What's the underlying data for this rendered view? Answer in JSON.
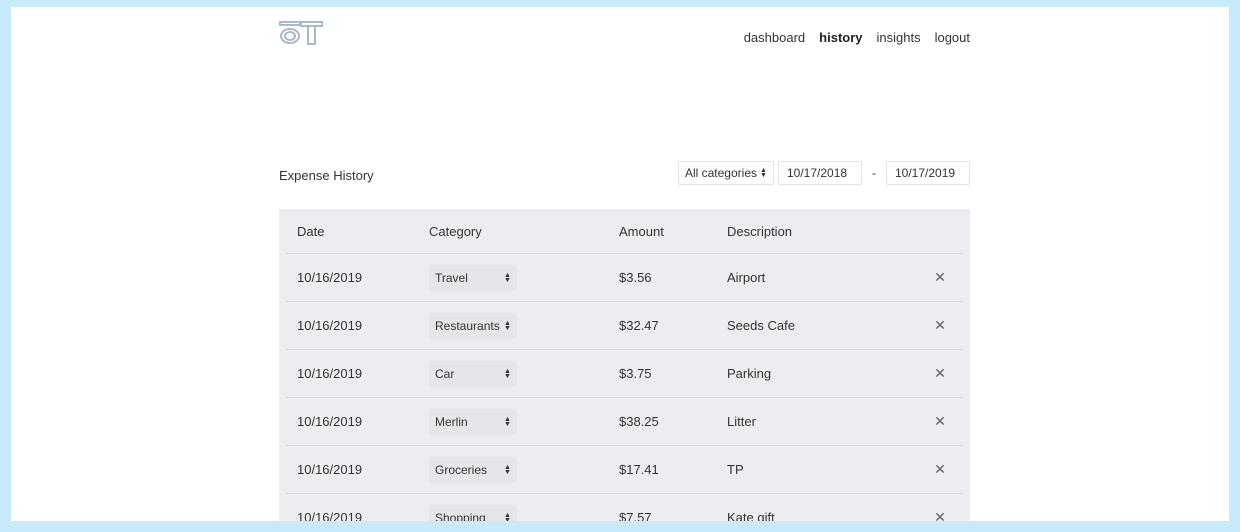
{
  "header": {
    "logo_text": "OT",
    "nav": [
      {
        "label": "dashboard",
        "active": false
      },
      {
        "label": "history",
        "active": true
      },
      {
        "label": "insights",
        "active": false
      },
      {
        "label": "logout",
        "active": false
      }
    ]
  },
  "toolbar": {
    "title": "Expense History",
    "category_filter": "All categories",
    "date_from": "10/17/2018",
    "date_separator": "-",
    "date_to": "10/17/2019"
  },
  "table": {
    "columns": [
      "Date",
      "Category",
      "Amount",
      "Description"
    ],
    "rows": [
      {
        "date": "10/16/2019",
        "category": "Travel",
        "amount": "$3.56",
        "description": "Airport"
      },
      {
        "date": "10/16/2019",
        "category": "Restaurants",
        "amount": "$32.47",
        "description": "Seeds Cafe"
      },
      {
        "date": "10/16/2019",
        "category": "Car",
        "amount": "$3.75",
        "description": "Parking"
      },
      {
        "date": "10/16/2019",
        "category": "Merlin",
        "amount": "$38.25",
        "description": "Litter"
      },
      {
        "date": "10/16/2019",
        "category": "Groceries",
        "amount": "$17.41",
        "description": "TP"
      },
      {
        "date": "10/16/2019",
        "category": "Shopping",
        "amount": "$7.57",
        "description": "Kate gift"
      }
    ],
    "delete_glyph": "✕"
  },
  "colors": {
    "background": "#c8ebfb",
    "logo": "#aab9c9",
    "table_bg": "#ededf1"
  }
}
